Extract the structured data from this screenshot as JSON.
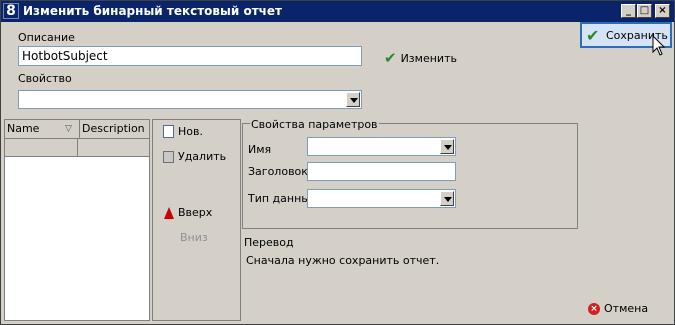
{
  "window": {
    "title": "Изменить бинарный текстовый отчет",
    "app_icon": "8",
    "minimize_icon": "_",
    "maximize_icon": "□",
    "close_icon": "×"
  },
  "description": {
    "label": "Описание",
    "value": "HotbotSubject"
  },
  "edit_button": {
    "label": "Изменить",
    "icon": "✔"
  },
  "property": {
    "label": "Свойство",
    "value": ""
  },
  "save_button": {
    "label": "Сохранить",
    "icon": "✔"
  },
  "grid": {
    "columns": [
      "Name",
      "Description"
    ],
    "filter_icon": "▽"
  },
  "actions": {
    "new": "Нов.",
    "delete": "Удалить",
    "up": "Вверх",
    "down": "Вниз"
  },
  "params": {
    "title": "Свойства параметров",
    "name_label": "Имя",
    "caption_label": "Заголовок",
    "type_label": "Тип данных"
  },
  "translation": {
    "label": "Перевод",
    "message": "Сначала нужно сохранить отчет."
  },
  "cancel_button": {
    "label": "Отмена",
    "icon": "×"
  }
}
